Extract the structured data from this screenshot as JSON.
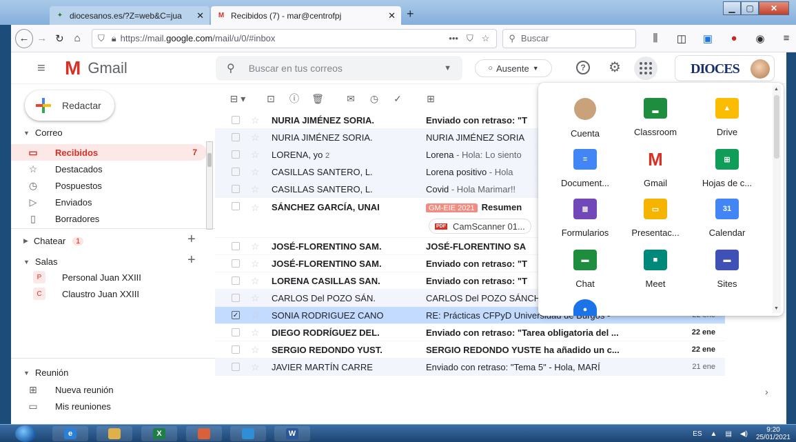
{
  "browser": {
    "tabs": [
      {
        "title": "diocesanos.es/?Z=web&C=jua",
        "close": "✕"
      },
      {
        "title": "Recibidos (7) - mar@centrofpj",
        "close": "✕"
      }
    ],
    "new_tab": "+",
    "url_prefix": "https://mail.",
    "url_host": "google.com",
    "url_path": "/mail/u/0/#inbox",
    "search_placeholder": "Buscar",
    "url_more": "•••"
  },
  "gmail": {
    "app_name": "Gmail",
    "search_placeholder": "Buscar en tus correos",
    "status": "Ausente",
    "brand": "DIOCES"
  },
  "sidebar": {
    "compose": "Redactar",
    "mail_section": "Correo",
    "items": [
      {
        "label": "Recibidos",
        "count": "7",
        "icon": "inbox-icon",
        "glyph": "▭"
      },
      {
        "label": "Destacados",
        "count": "",
        "icon": "star-icon",
        "glyph": "☆"
      },
      {
        "label": "Pospuestos",
        "count": "",
        "icon": "clock-icon",
        "glyph": "◷"
      },
      {
        "label": "Enviados",
        "count": "",
        "icon": "send-icon",
        "glyph": "▷"
      },
      {
        "label": "Borradores",
        "count": "",
        "icon": "draft-icon",
        "glyph": "▯"
      }
    ],
    "chat_section": "Chatear",
    "chat_badge": "1",
    "rooms_section": "Salas",
    "rooms": [
      {
        "initial": "P",
        "label": "Personal Juan XXIII"
      },
      {
        "initial": "C",
        "label": "Claustro Juan XXIII"
      }
    ],
    "meet_section": "Reunión",
    "meet_items": [
      {
        "label": "Nueva reunión",
        "glyph": "⊞"
      },
      {
        "label": "Mis reuniones",
        "glyph": "▭"
      }
    ]
  },
  "emails": [
    {
      "sender": "NURIA JIMÉNEZ SORIA.",
      "count": "",
      "subject": "Enviado con retraso: \"T",
      "snippet": "",
      "label": "",
      "date": "",
      "unread": true,
      "selected": false
    },
    {
      "sender": "NURIA JIMÉNEZ SORIA.",
      "count": "",
      "subject": "NURIA JIMÉNEZ SORIA",
      "snippet": "",
      "label": "",
      "date": "",
      "unread": false,
      "selected": false
    },
    {
      "sender": "LORENA, yo",
      "count": "2",
      "subject": "Lorena",
      "snippet": " - Hola: Lo siento",
      "label": "",
      "date": "",
      "unread": false,
      "selected": false
    },
    {
      "sender": "CASILLAS SANTERO, L.",
      "count": "",
      "subject": "Lorena positivo",
      "snippet": " - Hola",
      "label": "",
      "date": "",
      "unread": false,
      "selected": false
    },
    {
      "sender": "CASILLAS SANTERO, L.",
      "count": "",
      "subject": "Covid",
      "snippet": " - Hola Marimar!!",
      "label": "",
      "date": "",
      "unread": false,
      "selected": false
    },
    {
      "sender": "SÁNCHEZ GARCÍA, UNAI",
      "count": "",
      "subject": "Resumen",
      "snippet": "",
      "label": "GM-EIE 2021",
      "date": "",
      "unread": true,
      "selected": false,
      "attachment": "CamScanner 01..."
    },
    {
      "sender": "JOSÉ-FLORENTINO SAM.",
      "count": "",
      "subject": "JOSÉ-FLORENTINO SA",
      "snippet": "",
      "label": "",
      "date": "",
      "unread": true,
      "selected": false
    },
    {
      "sender": "JOSÉ-FLORENTINO SAM.",
      "count": "",
      "subject": "Enviado con retraso: \"T",
      "snippet": "",
      "label": "",
      "date": "",
      "unread": true,
      "selected": false
    },
    {
      "sender": "LORENA CASILLAS SAN.",
      "count": "",
      "subject": "Enviado con retraso: \"T",
      "snippet": "",
      "label": "",
      "date": "",
      "unread": true,
      "selected": false
    },
    {
      "sender": "CARLOS Del POZO SÁN.",
      "count": "",
      "subject": "CARLOS Del POZO SÁNCHEZ ha añadido u...",
      "snippet": "",
      "label": "",
      "date": "22 ene",
      "unread": false,
      "selected": false
    },
    {
      "sender": "SONIA RODRIGUEZ CANO",
      "count": "",
      "subject": "RE: Prácticas CFPyD Universidad de Burgos -",
      "snippet": "",
      "label": "",
      "date": "22 ene",
      "unread": false,
      "selected": true
    },
    {
      "sender": "DIEGO RODRÍGUEZ DEL.",
      "count": "",
      "subject": "Enviado con retraso: \"Tarea obligatoria del ...",
      "snippet": "",
      "label": "",
      "date": "22 ene",
      "unread": true,
      "selected": false
    },
    {
      "sender": "SERGIO REDONDO YUST.",
      "count": "",
      "subject": "SERGIO REDONDO YUSTE ha añadido un c...",
      "snippet": "",
      "label": "",
      "date": "22 ene",
      "unread": true,
      "selected": false
    },
    {
      "sender": "JAVIER MARTÍN CARRE",
      "count": "",
      "subject": "Enviado con retraso: \"Tema 5\" - Hola, MARÍ",
      "snippet": "",
      "label": "",
      "date": "21 ene",
      "unread": false,
      "selected": false
    }
  ],
  "apps": [
    {
      "name": "Cuenta",
      "icon": "account-avatar-icon",
      "color": "#c9a27c",
      "glyph": ""
    },
    {
      "name": "Classroom",
      "icon": "classroom-icon",
      "color": "#1e8e3e",
      "glyph": "▂"
    },
    {
      "name": "Drive",
      "icon": "drive-icon",
      "color": "#fbbc04",
      "glyph": "▲"
    },
    {
      "name": "Document...",
      "icon": "docs-icon",
      "color": "#4285f4",
      "glyph": "≡"
    },
    {
      "name": "Gmail",
      "icon": "gmail-icon",
      "color": "#ffffff",
      "glyph": "M"
    },
    {
      "name": "Hojas de c...",
      "icon": "sheets-icon",
      "color": "#0f9d58",
      "glyph": "⊞"
    },
    {
      "name": "Formularios",
      "icon": "forms-icon",
      "color": "#7248b9",
      "glyph": "≣"
    },
    {
      "name": "Presentac...",
      "icon": "slides-icon",
      "color": "#f4b400",
      "glyph": "▭"
    },
    {
      "name": "Calendar",
      "icon": "calendar-icon",
      "color": "#4285f4",
      "glyph": "31"
    },
    {
      "name": "Chat",
      "icon": "chat-icon",
      "color": "#1e8e3e",
      "glyph": "▬"
    },
    {
      "name": "Meet",
      "icon": "meet-icon",
      "color": "#00897b",
      "glyph": "■"
    },
    {
      "name": "Sites",
      "icon": "sites-icon",
      "color": "#3f51b5",
      "glyph": "▬"
    },
    {
      "name": "",
      "icon": "contacts-icon",
      "color": "#1a73e8",
      "glyph": "●"
    }
  ],
  "taskbar": {
    "lang": "ES",
    "time": "9:20",
    "date": "25/01/2021",
    "apps": [
      {
        "icon": "ie-icon",
        "label": "e"
      },
      {
        "icon": "explorer-icon",
        "label": ""
      },
      {
        "icon": "excel-icon",
        "label": "X"
      },
      {
        "icon": "paint-icon",
        "label": ""
      },
      {
        "icon": "edge-icon",
        "label": ""
      },
      {
        "icon": "word-icon",
        "label": "W"
      }
    ]
  },
  "colors": {
    "accent_red": "#d93025",
    "selected_row": "#c2dbff",
    "label_chip": "#f28b82"
  }
}
